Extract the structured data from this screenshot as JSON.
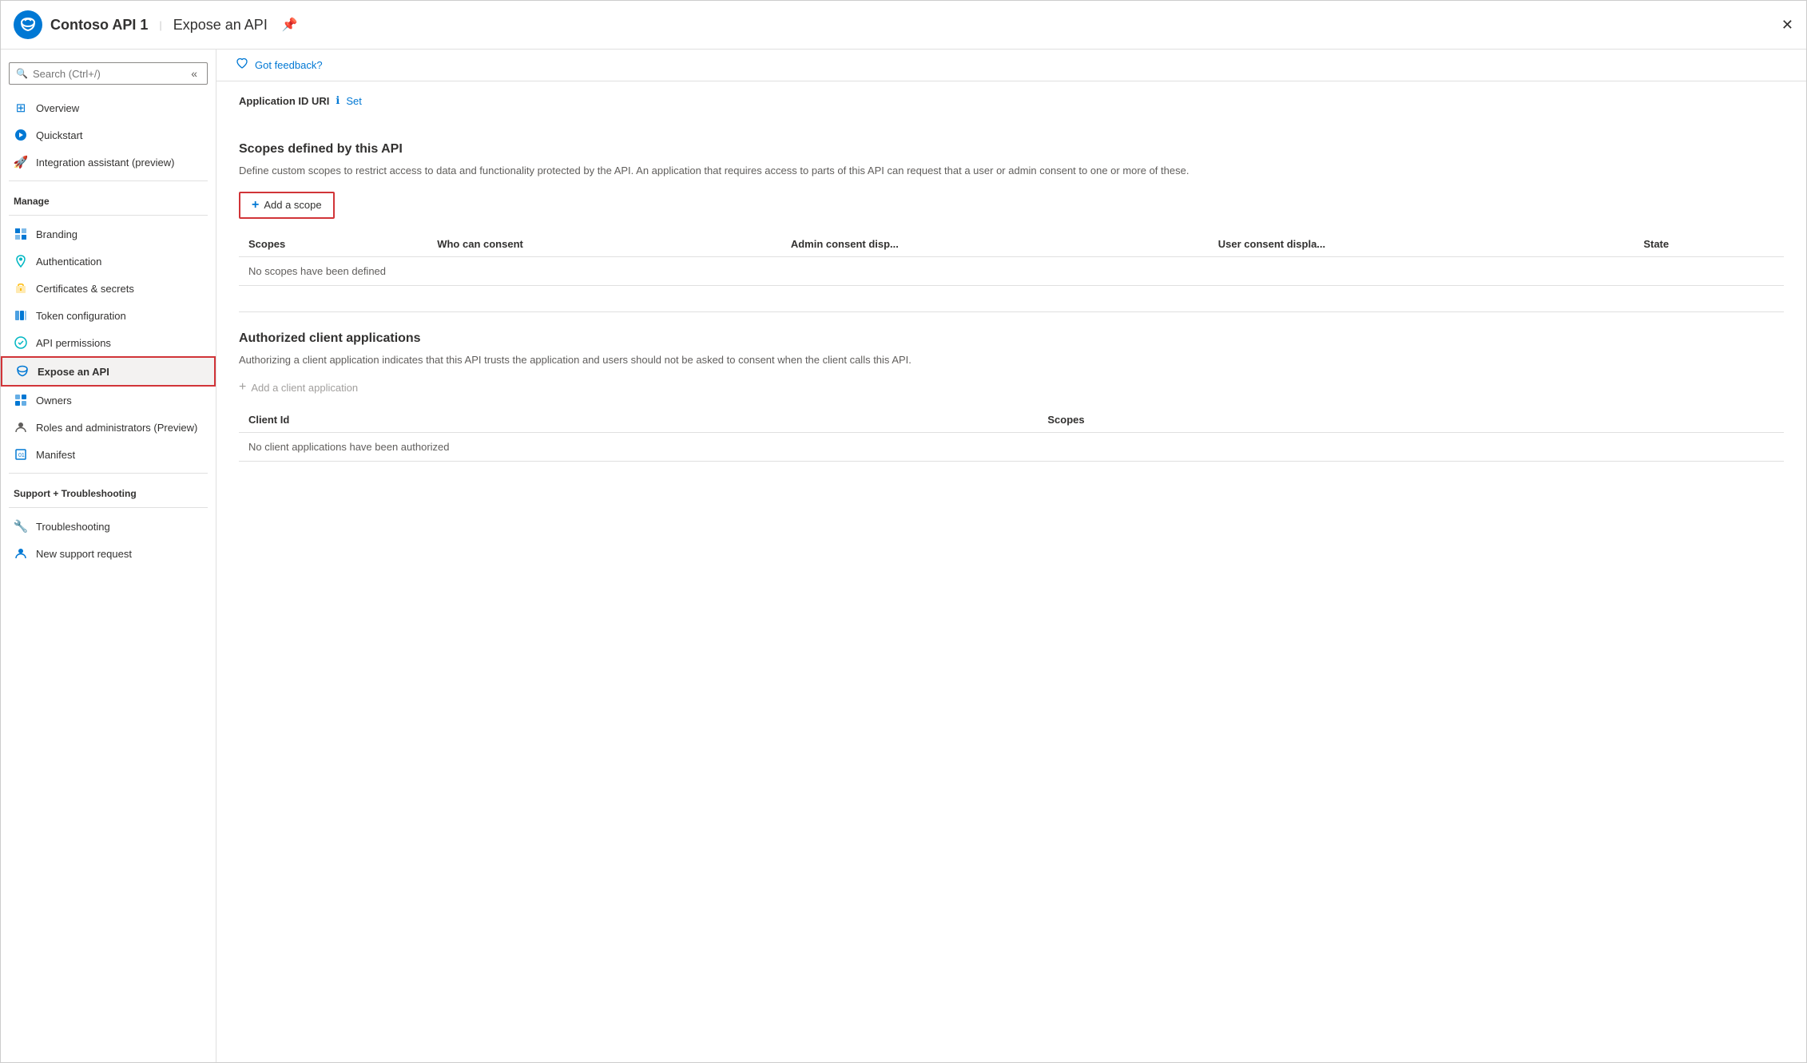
{
  "header": {
    "app_name": "Contoso API 1",
    "separator": "|",
    "page_title": "Expose an API",
    "pin_icon": "📌",
    "close_icon": "✕"
  },
  "sidebar": {
    "search_placeholder": "Search (Ctrl+/)",
    "collapse_icon": "«",
    "nav_items": [
      {
        "id": "overview",
        "label": "Overview",
        "icon": "⊞",
        "icon_color": "icon-blue"
      },
      {
        "id": "quickstart",
        "label": "Quickstart",
        "icon": "☁",
        "icon_color": "icon-blue"
      },
      {
        "id": "integration-assistant",
        "label": "Integration assistant (preview)",
        "icon": "🚀",
        "icon_color": "icon-orange"
      }
    ],
    "manage_label": "Manage",
    "manage_items": [
      {
        "id": "branding",
        "label": "Branding",
        "icon": "⊟",
        "icon_color": "icon-blue"
      },
      {
        "id": "authentication",
        "label": "Authentication",
        "icon": "↻",
        "icon_color": "icon-teal"
      },
      {
        "id": "certificates",
        "label": "Certificates & secrets",
        "icon": "🔑",
        "icon_color": "icon-yellow"
      },
      {
        "id": "token-config",
        "label": "Token configuration",
        "icon": "⊟",
        "icon_color": "icon-blue"
      },
      {
        "id": "api-permissions",
        "label": "API permissions",
        "icon": "⊙",
        "icon_color": "icon-teal"
      },
      {
        "id": "expose-api",
        "label": "Expose an API",
        "icon": "☁",
        "icon_color": "icon-blue",
        "active": true
      }
    ],
    "other_items": [
      {
        "id": "owners",
        "label": "Owners",
        "icon": "⊞",
        "icon_color": "icon-blue"
      },
      {
        "id": "roles",
        "label": "Roles and administrators (Preview)",
        "icon": "👤",
        "icon_color": "icon-gray"
      },
      {
        "id": "manifest",
        "label": "Manifest",
        "icon": "⊟",
        "icon_color": "icon-blue"
      }
    ],
    "support_label": "Support + Troubleshooting",
    "support_items": [
      {
        "id": "troubleshooting",
        "label": "Troubleshooting",
        "icon": "🔧",
        "icon_color": "icon-gray"
      },
      {
        "id": "new-support",
        "label": "New support request",
        "icon": "👤",
        "icon_color": "icon-blue"
      }
    ]
  },
  "content": {
    "feedback_label": "Got feedback?",
    "app_id_uri_label": "Application ID URI",
    "set_label": "Set",
    "scopes_section": {
      "title": "Scopes defined by this API",
      "description": "Define custom scopes to restrict access to data and functionality protected by the API. An application that requires access to parts of this API can request that a user or admin consent to one or more of these.",
      "add_scope_label": "Add a scope",
      "table_headers": [
        "Scopes",
        "Who can consent",
        "Admin consent disp...",
        "User consent displa...",
        "State"
      ],
      "no_data_message": "No scopes have been defined"
    },
    "authorized_clients_section": {
      "title": "Authorized client applications",
      "description": "Authorizing a client application indicates that this API trusts the application and users should not be asked to consent when the client calls this API.",
      "add_client_label": "Add a client application",
      "table_headers": [
        "Client Id",
        "Scopes"
      ],
      "no_data_message": "No client applications have been authorized"
    }
  }
}
